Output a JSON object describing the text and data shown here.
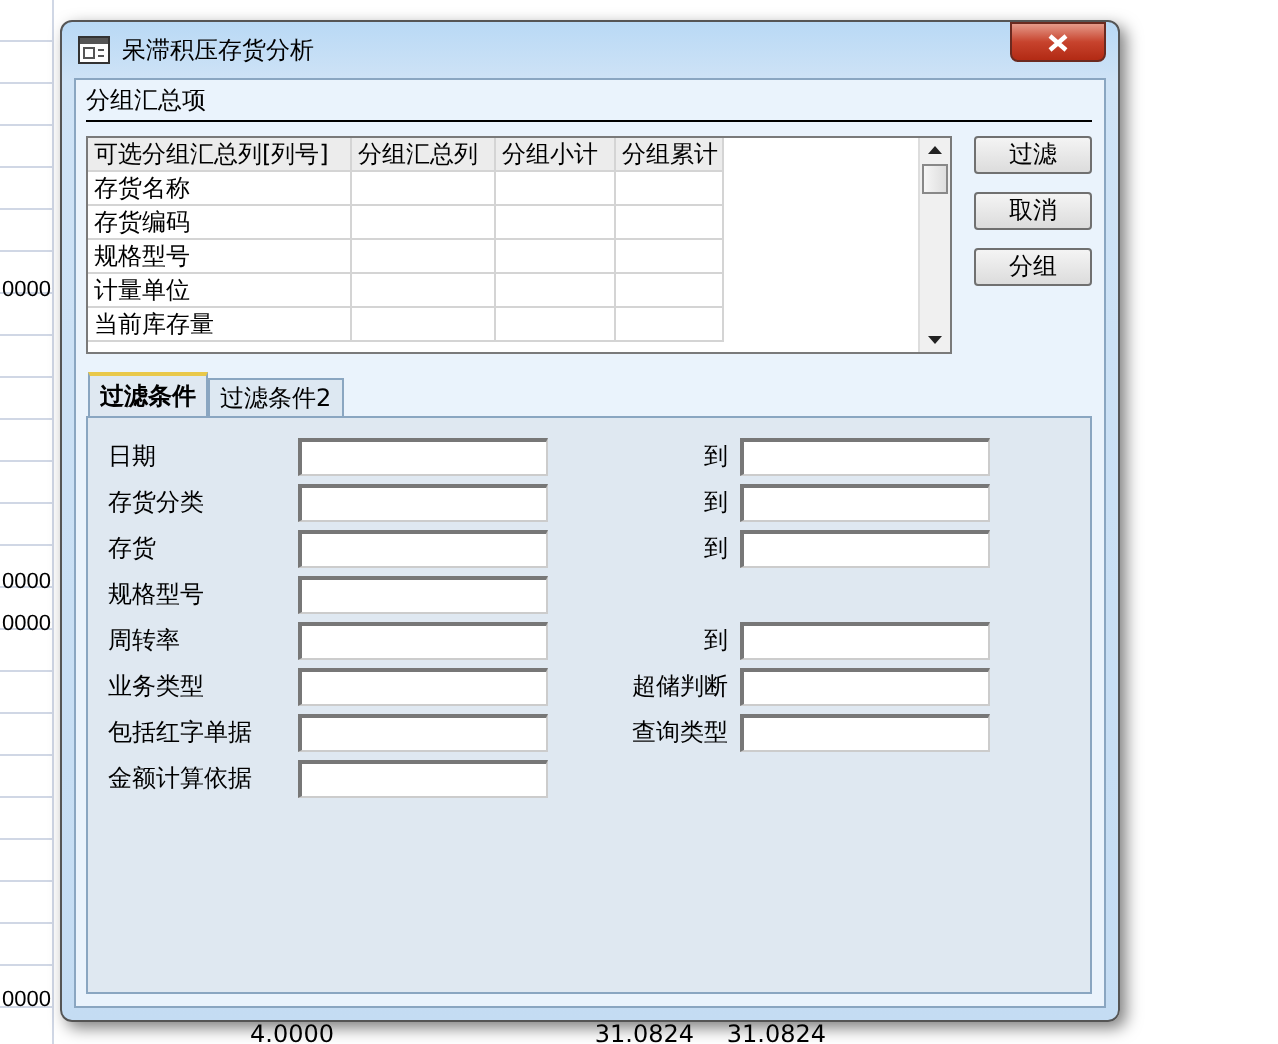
{
  "background_sheet": {
    "left_cells": [
      "0000",
      "0000",
      "0000",
      "0000"
    ],
    "bottom_cells": [
      "4.0000",
      "31.0824",
      "31.0824"
    ]
  },
  "window": {
    "title": "呆滞积压存货分析"
  },
  "group_section": {
    "title": "分组汇总项",
    "columns": [
      "可选分组汇总列[列号]",
      "分组汇总列",
      "分组小计",
      "分组累计"
    ],
    "rows": [
      "存货名称",
      "存货编码",
      "规格型号",
      "计量单位",
      "当前库存量"
    ]
  },
  "buttons": [
    "过滤",
    "取消",
    "分组"
  ],
  "tabs": [
    {
      "label": "过滤条件",
      "selected": true
    },
    {
      "label": "过滤条件2",
      "selected": false
    }
  ],
  "filters": [
    {
      "label": "日期",
      "to_label": "到"
    },
    {
      "label": "存货分类",
      "to_label": "到"
    },
    {
      "label": "存货",
      "to_label": "到"
    },
    {
      "label": "规格型号"
    },
    {
      "label": "周转率",
      "to_label": "到"
    },
    {
      "label": "业务类型",
      "to_label": "超储判断"
    },
    {
      "label": "包括红字单据",
      "to_label": "查询类型"
    },
    {
      "label": "金额计算依据"
    }
  ]
}
